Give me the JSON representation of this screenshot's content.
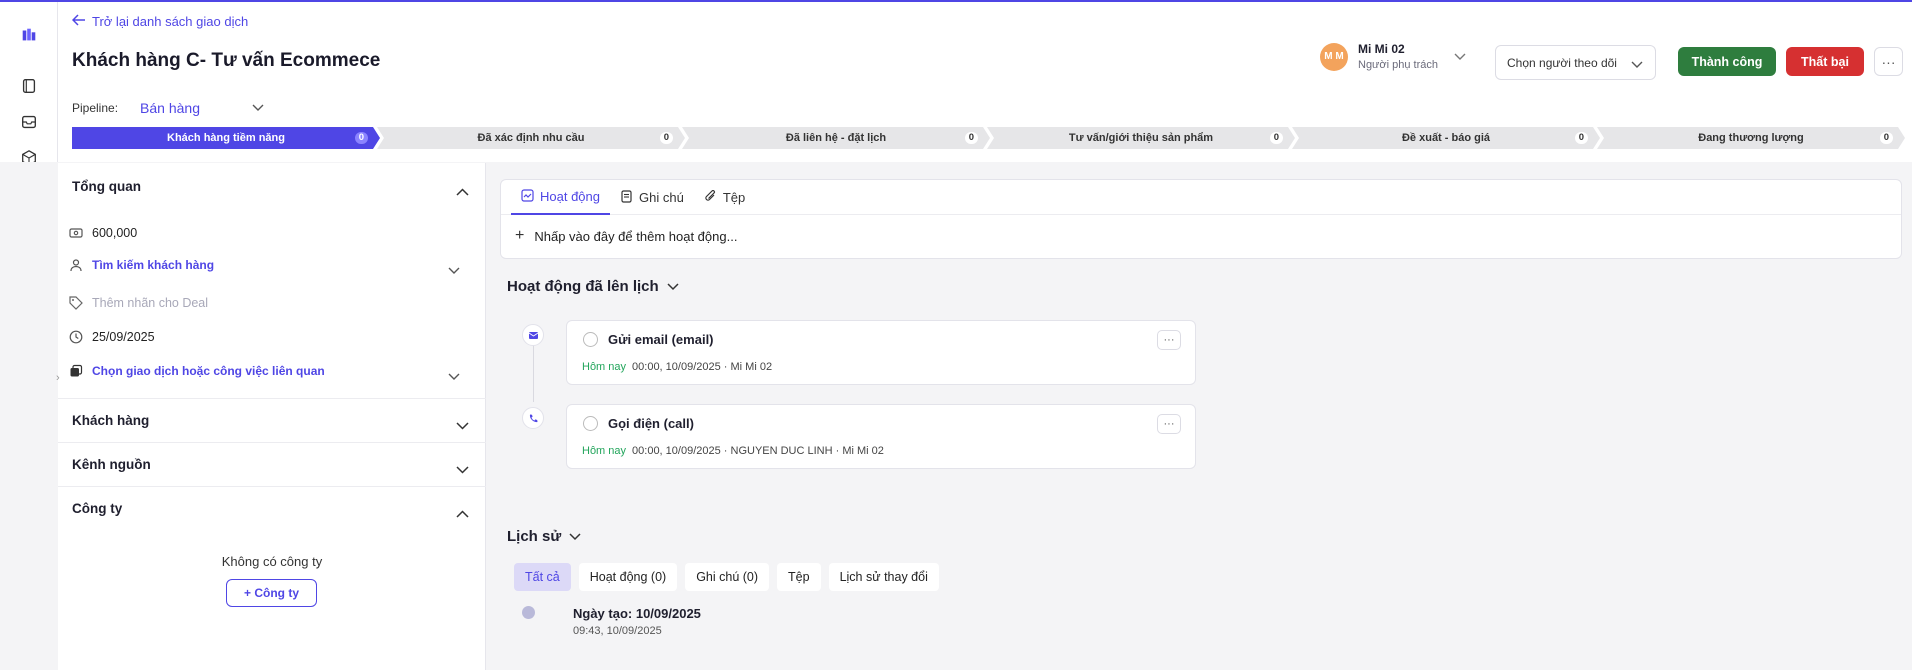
{
  "back_link": "Trở lại danh sách giao dịch",
  "deal_title": "Khách hàng C- Tư vấn Ecommece",
  "owner": {
    "initials": "M M",
    "name": "Mi Mi 02",
    "role": "Người phụ trách"
  },
  "follower_select": {
    "placeholder": "Chọn người theo dõi"
  },
  "actions": {
    "win": "Thành công",
    "lose": "Thất bại",
    "more": "···"
  },
  "pipeline": {
    "label": "Pipeline:",
    "value": "Bán hàng"
  },
  "stages": [
    {
      "label": "Khách hàng tiềm năng",
      "count": "0",
      "active": true
    },
    {
      "label": "Đã xác định nhu cầu",
      "count": "0"
    },
    {
      "label": "Đã liên hệ - đặt lịch",
      "count": "0"
    },
    {
      "label": "Tư vấn/giới thiệu sản phẩm",
      "count": "0"
    },
    {
      "label": "Đề xuất - báo giá",
      "count": "0"
    },
    {
      "label": "Đang thương lượng",
      "count": "0"
    }
  ],
  "overview": {
    "title": "Tổng quan",
    "amount": "600,000",
    "customer_link": "Tìm kiếm khách hàng",
    "tag_placeholder": "Thêm nhãn cho Deal",
    "date": "25/09/2025",
    "related_link": "Chọn giao dịch hoặc công việc liên quan"
  },
  "sections": {
    "customer": "Khách hàng",
    "source": "Kênh nguồn",
    "company": "Công ty"
  },
  "company": {
    "empty_text": "Không có công ty",
    "add_button": "+  Công ty"
  },
  "activity_tabs": [
    "Hoạt động",
    "Ghi chú",
    "Tệp"
  ],
  "add_activity": "Nhấp vào đây để thêm hoạt động...",
  "scheduled": {
    "title": "Hoạt động đã lên lịch",
    "items": [
      {
        "title": "Gửi email (email)",
        "today": "Hôm nay",
        "meta": "00:00, 10/09/2025 · Mi Mi 02"
      },
      {
        "title": "Gọi điện (call)",
        "today": "Hôm nay",
        "meta": "00:00, 10/09/2025 · NGUYEN DUC LINH · Mi Mi 02"
      }
    ]
  },
  "history": {
    "title": "Lịch sử",
    "filters": [
      "Tất cả",
      "Hoạt động (0)",
      "Ghi chú (0)",
      "Tệp",
      "Lịch sử thay đổi"
    ],
    "entry_title": "Ngày tạo: 10/09/2025",
    "entry_time": "09:43, 10/09/2025"
  },
  "colors": {
    "accent": "#4f46e5",
    "success": "#2e7d3e",
    "danger": "#d63031",
    "today": "#22a55b"
  }
}
